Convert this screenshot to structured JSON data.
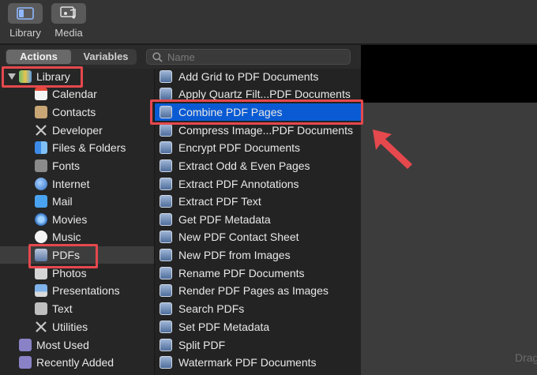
{
  "toolbar": {
    "library_label": "Library",
    "media_label": "Media"
  },
  "tabs": {
    "actions": "Actions",
    "variables": "Variables"
  },
  "search": {
    "placeholder": "Name",
    "value": ""
  },
  "library": {
    "root_label": "Library",
    "items": [
      {
        "label": "Calendar",
        "icon": "calendar-icon"
      },
      {
        "label": "Contacts",
        "icon": "contacts-icon"
      },
      {
        "label": "Developer",
        "icon": "developer-tools-icon"
      },
      {
        "label": "Files & Folders",
        "icon": "finder-icon"
      },
      {
        "label": "Fonts",
        "icon": "fonts-icon"
      },
      {
        "label": "Internet",
        "icon": "globe-icon"
      },
      {
        "label": "Mail",
        "icon": "mail-icon"
      },
      {
        "label": "Movies",
        "icon": "movies-icon"
      },
      {
        "label": "Music",
        "icon": "music-icon"
      },
      {
        "label": "PDFs",
        "icon": "pdf-icon",
        "selected": true
      },
      {
        "label": "Photos",
        "icon": "photos-icon"
      },
      {
        "label": "Presentations",
        "icon": "presentation-icon"
      },
      {
        "label": "Text",
        "icon": "text-icon"
      },
      {
        "label": "Utilities",
        "icon": "utilities-icon"
      }
    ],
    "smart_groups": [
      {
        "label": "Most Used",
        "icon": "smart-folder-icon"
      },
      {
        "label": "Recently Added",
        "icon": "smart-folder-icon"
      }
    ]
  },
  "actions": {
    "selected_index": 2,
    "items": [
      "Add Grid to PDF Documents",
      "Apply Quartz Filt...PDF Documents",
      "Combine PDF Pages",
      "Compress Image...PDF Documents",
      "Encrypt PDF Documents",
      "Extract Odd & Even Pages",
      "Extract PDF Annotations",
      "Extract PDF Text",
      "Get PDF Metadata",
      "New PDF Contact Sheet",
      "New PDF from Images",
      "Rename PDF Documents",
      "Render PDF Pages as Images",
      "Search PDFs",
      "Set PDF Metadata",
      "Split PDF",
      "Watermark PDF Documents"
    ]
  },
  "workflow": {
    "drag_hint": "Drag"
  },
  "colors": {
    "selection": "#0a5bd3",
    "annotation_red": "#e5484d"
  }
}
